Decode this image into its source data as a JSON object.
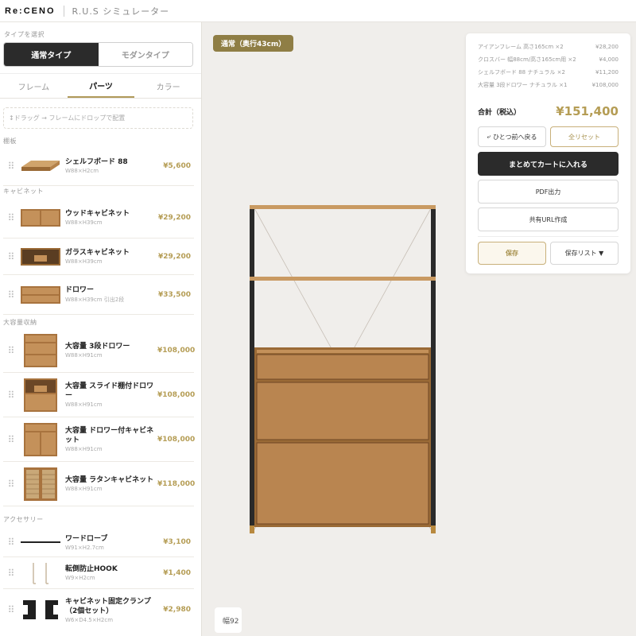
{
  "header": {
    "logo": "Re:CENO",
    "title": "R.U.S シミュレーター"
  },
  "sidebar": {
    "type_label": "タイプを選択",
    "types": [
      {
        "label": "通常タイプ",
        "active": true
      },
      {
        "label": "モダンタイプ",
        "active": false
      }
    ],
    "tabs": [
      {
        "label": "フレーム"
      },
      {
        "label": "パーツ"
      },
      {
        "label": "カラー"
      }
    ],
    "drop_hint": "↕ドラッグ → フレームにドロップで配置",
    "categories": [
      {
        "label": "棚板",
        "items": [
          {
            "name": "シェルフボード 88",
            "size": "W88×H2cm",
            "price": "¥5,600",
            "thumb": "shelf-board-thumb"
          }
        ]
      },
      {
        "label": "キャビネット",
        "items": [
          {
            "name": "ウッドキャビネット",
            "size": "W88×H39cm",
            "price": "¥29,200",
            "thumb": "wood-cabinet-thumb"
          },
          {
            "name": "ガラスキャビネット",
            "size": "W88×H39cm",
            "price": "¥29,200",
            "thumb": "glass-cabinet-thumb"
          },
          {
            "name": "ドロワー",
            "size": "W88×H39cm 引出2段",
            "price": "¥33,500",
            "thumb": "drawer-thumb"
          }
        ]
      },
      {
        "label": "大容量収納",
        "items": [
          {
            "name": "大容量 3段ドロワー",
            "size": "W88×H91cm",
            "price": "¥108,000",
            "thumb": "3-drawer-thumb"
          },
          {
            "name": "大容量 スライド棚付ドロワー",
            "size": "W88×H91cm",
            "price": "¥108,000",
            "thumb": "slide-shelf-drawer-thumb"
          },
          {
            "name": "大容量 ドロワー付キャビネット",
            "size": "W88×H91cm",
            "price": "¥108,000",
            "thumb": "drawer-cabinet-thumb"
          },
          {
            "name": "大容量 ラタンキャビネット",
            "size": "W88×H91cm",
            "price": "¥118,000",
            "thumb": "rattan-cabinet-thumb"
          }
        ]
      },
      {
        "label": "アクセサリー",
        "items": [
          {
            "name": "ワードローブ",
            "size": "W91×H2.7cm",
            "price": "¥3,100",
            "thumb": "wardrobe-bar-thumb"
          },
          {
            "name": "転倒防止HOOK",
            "size": "W9×H2cm",
            "price": "¥1,400",
            "thumb": "hook-thumb"
          },
          {
            "name": "キャビネット固定クランプ（2個セット）",
            "size": "W6×D4.5×H2cm",
            "price": "¥2,980",
            "thumb": "clamp-thumb"
          }
        ]
      }
    ]
  },
  "canvas": {
    "depth_badge": "通常（奥行43cm）",
    "width_readout": "幅92"
  },
  "summary": {
    "lines": [
      {
        "label": "アイアンフレーム 高さ165cm ×2",
        "price": "¥28,200"
      },
      {
        "label": "クロスバー 幅88cm/高さ165cm用 ×2",
        "price": "¥4,000"
      },
      {
        "label": "シェルフボード 88 ナチュラル ×2",
        "price": "¥11,200"
      },
      {
        "label": "大容量 3段ドロワー ナチュラル ×1",
        "price": "¥108,000"
      }
    ],
    "total_label": "合計（税込）",
    "total_value": "¥151,400",
    "undo_label": "ひとつ前へ戻る",
    "reset_label": "全リセット",
    "cart_label": "まとめてカートに入れる",
    "pdf_label": "PDF出力",
    "share_label": "共有URL作成",
    "save_label": "保存",
    "savelist_label": "保存リスト ▼"
  },
  "colors": {
    "accent_gold": "#b59d55",
    "badge": "#8f7e45",
    "dark": "#2b2b2b",
    "wood": "#b88552",
    "frame": "#2a2a2a"
  },
  "icons": {
    "undo": "undo-arrow-icon",
    "grip": "drag-grip-icon"
  }
}
